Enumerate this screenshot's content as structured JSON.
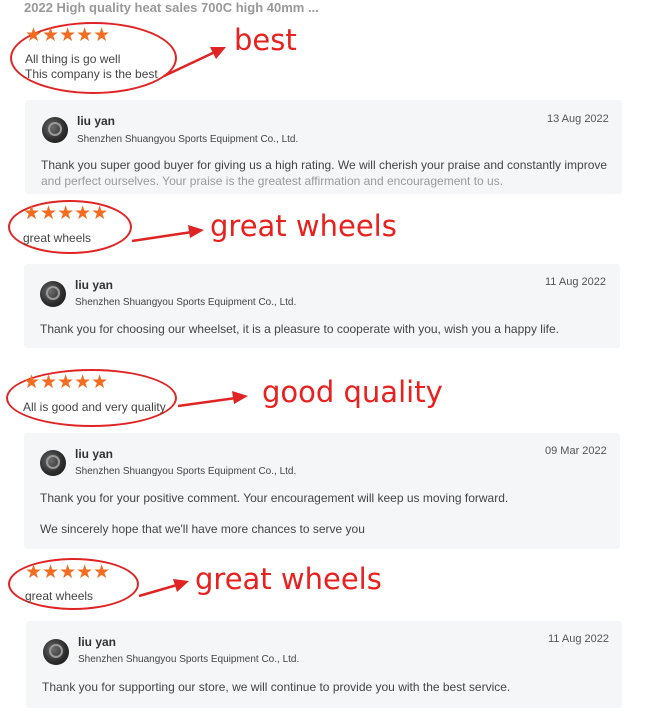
{
  "product_title": "2022 High quality heat sales 700C high 40mm ...",
  "colors": {
    "star": "#f36c21",
    "annotation": "#e8201e",
    "card_bg": "#f5f6f8"
  },
  "icons": {
    "star": "star-icon",
    "avatar": "avatar-wheel-image",
    "arrow": "red-arrow"
  },
  "reviews": [
    {
      "stars": "★★★★★",
      "rating": 5,
      "text_lines": [
        "All thing is go well",
        "This company is the best"
      ],
      "annotation": "best",
      "reply": {
        "author": "liu yan",
        "company": "Shenzhen Shuangyou Sports Equipment Co., Ltd.",
        "date": "13 Aug 2022",
        "lines": [
          "Thank you super good buyer for giving us a high rating. We will cherish your praise and constantly improve",
          "and perfect ourselves. Your praise is the greatest affirmation and encouragement to us."
        ]
      }
    },
    {
      "stars": "★★★★★",
      "rating": 5,
      "text_lines": [
        "great wheels"
      ],
      "annotation": "great wheels",
      "reply": {
        "author": "liu yan",
        "company": "Shenzhen Shuangyou Sports Equipment Co., Ltd.",
        "date": "11 Aug 2022",
        "lines": [
          "Thank you for choosing our wheelset, it is a pleasure to cooperate with you, wish you a happy life."
        ]
      }
    },
    {
      "stars": "★★★★★",
      "rating": 5,
      "text_lines": [
        "All is good and very quality"
      ],
      "annotation": "good quality",
      "reply": {
        "author": "liu yan",
        "company": "Shenzhen Shuangyou Sports Equipment Co., Ltd.",
        "date": "09 Mar 2022",
        "lines": [
          "Thank you for your positive comment. Your encouragement will keep us moving forward.",
          "We sincerely hope that we'll have more chances to serve you"
        ]
      }
    },
    {
      "stars": "★★★★★",
      "rating": 5,
      "text_lines": [
        "great wheels"
      ],
      "annotation": "great wheels",
      "reply": {
        "author": "liu yan",
        "company": "Shenzhen Shuangyou Sports Equipment Co., Ltd.",
        "date": "11 Aug 2022",
        "lines": [
          "Thank you for supporting our store, we will continue to provide you with the best service."
        ]
      }
    }
  ]
}
